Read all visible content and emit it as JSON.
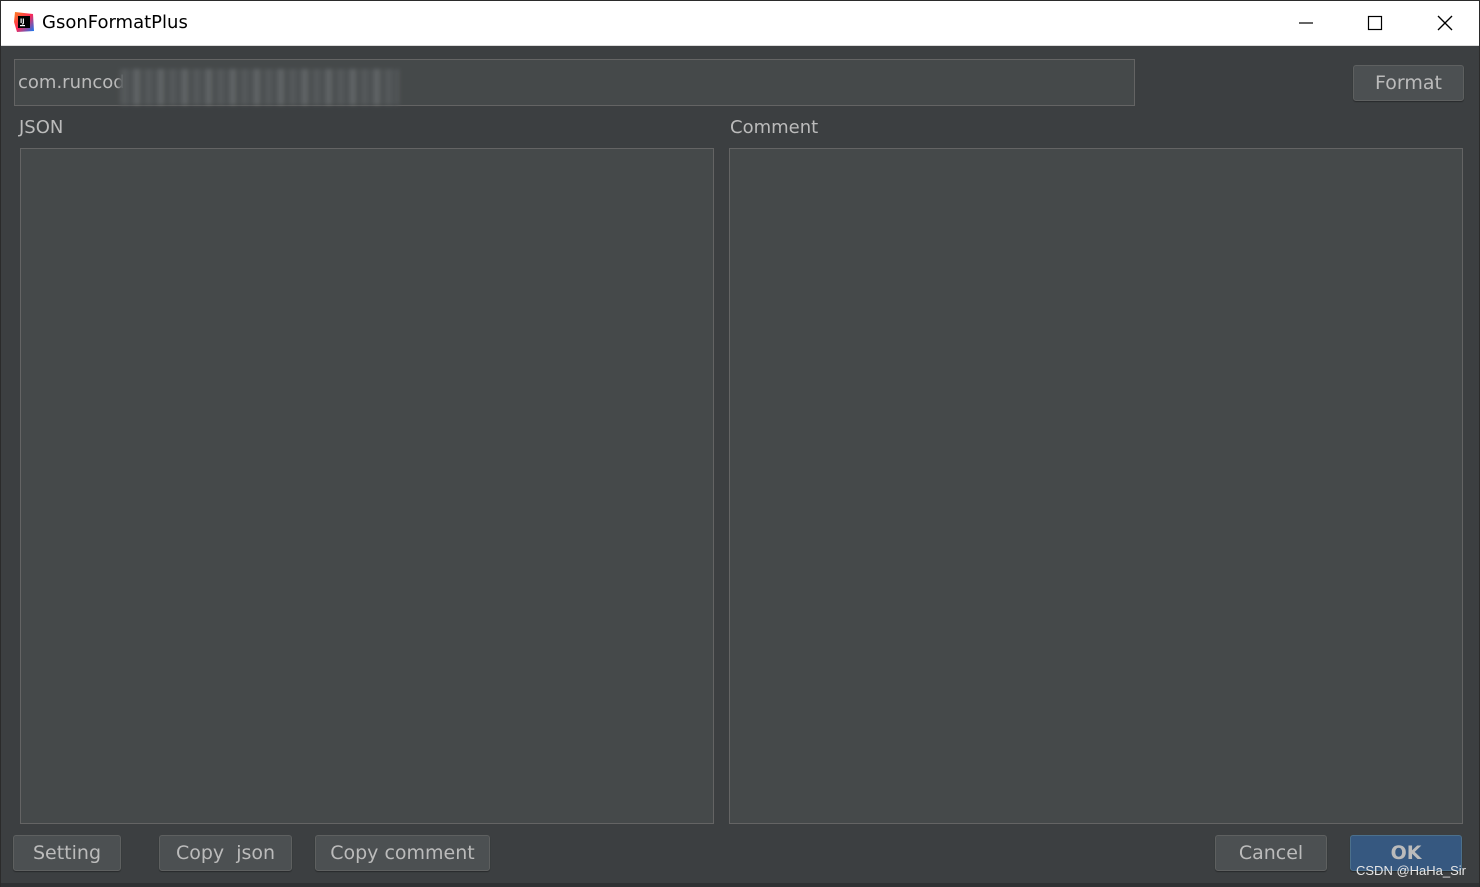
{
  "window": {
    "title": "GsonFormatPlus",
    "controls": {
      "minimize": "minimize-icon",
      "maximize": "maximize-icon",
      "close": "close-icon"
    }
  },
  "header": {
    "class_name_value": "com.runcod",
    "format_label": "Format"
  },
  "json_panel": {
    "label": "JSON",
    "value": ""
  },
  "comment_panel": {
    "label": "Comment",
    "value": ""
  },
  "footer": {
    "setting_label": "Setting",
    "copy_json_label": "Copy  json",
    "copy_comment_label": "Copy comment",
    "cancel_label": "Cancel",
    "ok_label": "OK"
  },
  "watermark": "CSDN @HaHa_Sir",
  "colors": {
    "background": "#3c3f41",
    "field_bg": "#45494a",
    "text": "#bbbbbb",
    "ok_button": "#365880"
  }
}
